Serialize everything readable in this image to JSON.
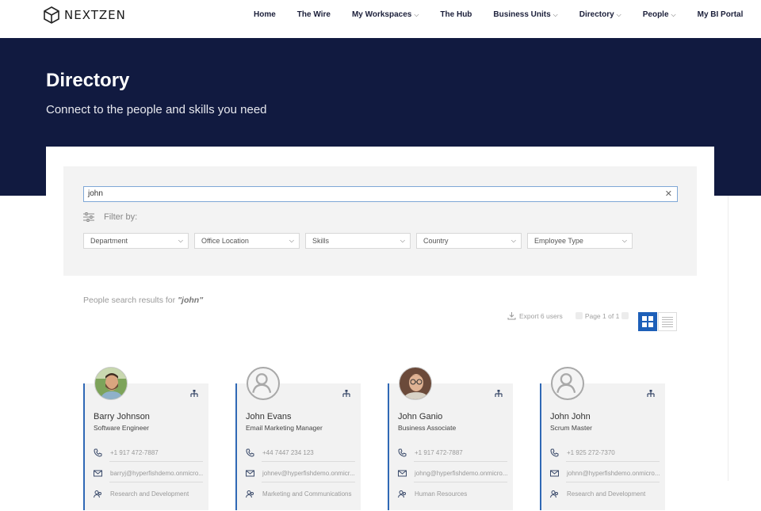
{
  "brand": {
    "name": "NEXTZEN"
  },
  "nav": [
    {
      "label": "Home",
      "chevron": false
    },
    {
      "label": "The Wire",
      "chevron": false
    },
    {
      "label": "My Workspaces",
      "chevron": true
    },
    {
      "label": "The Hub",
      "chevron": false
    },
    {
      "label": "Business Units",
      "chevron": true
    },
    {
      "label": "Directory",
      "chevron": true
    },
    {
      "label": "People",
      "chevron": true
    },
    {
      "label": "My BI Portal",
      "chevron": false
    }
  ],
  "hero": {
    "title": "Directory",
    "subtitle": "Connect to the people and skills you need"
  },
  "search": {
    "value": "john",
    "filter_label": "Filter by:",
    "filters": [
      "Department",
      "Office Location",
      "Skills",
      "Country",
      "Employee Type"
    ]
  },
  "results": {
    "prefix": "People search results for ",
    "query": "\"john\"",
    "export_label": "Export 6 users",
    "page_label": "Page 1 of 1"
  },
  "people": [
    {
      "name": "Barry Johnson",
      "title": "Software Engineer",
      "phone": "+1 917 472-7887",
      "email": "barryj@hyperfishdemo.onmicro...",
      "department": "Research and Development",
      "avatar": "photo-man-beard"
    },
    {
      "name": "John Evans",
      "title": "Email Marketing Manager",
      "phone": "+44 7447 234 123",
      "email": "johnev@hyperfishdemo.onmicr...",
      "department": "Marketing and Communications",
      "avatar": "placeholder"
    },
    {
      "name": "John Ganio",
      "title": "Business Associate",
      "phone": "+1 917 472-7887",
      "email": "johng@hyperfishdemo.onmicro...",
      "department": "Human Resources",
      "avatar": "photo-man-glasses"
    },
    {
      "name": "John John",
      "title": "Scrum Master",
      "phone": "+1 925 272-7370",
      "email": "johnn@hyperfishdemo.onmicro...",
      "department": "Research and Development",
      "avatar": "placeholder"
    }
  ],
  "colors": {
    "hero_bg": "#111a40",
    "accent": "#2f68b5",
    "grid_view_active": "#1d5fb8"
  }
}
